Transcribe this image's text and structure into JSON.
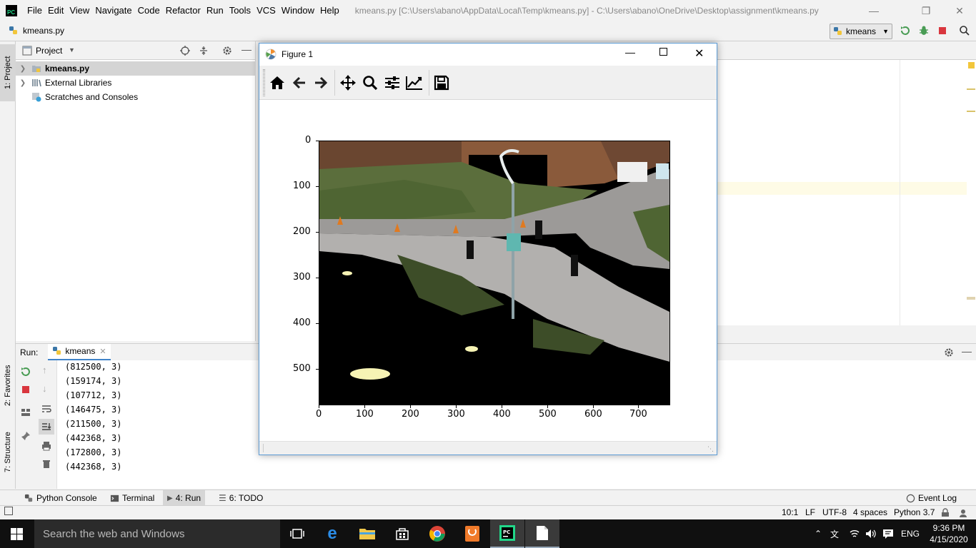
{
  "app": {
    "logo_text": "PC",
    "menu": [
      "File",
      "Edit",
      "View",
      "Navigate",
      "Code",
      "Refactor",
      "Run",
      "Tools",
      "VCS",
      "Window",
      "Help"
    ],
    "window_title": "kmeans.py [C:\\Users\\abano\\AppData\\Local\\Temp\\kmeans.py] - C:\\Users\\abano\\OneDrive\\Desktop\\assignment\\kmeans.py"
  },
  "navbar": {
    "file": "kmeans.py",
    "run_config": "kmeans"
  },
  "left_strip": {
    "project_tab": "1: Project",
    "favorites_tab": "2: Favorites",
    "structure_tab": "7: Structure"
  },
  "project": {
    "title": "Project",
    "items": [
      {
        "label": "kmeans.py"
      },
      {
        "label": "External Libraries"
      },
      {
        "label": "Scratches and Consoles"
      }
    ]
  },
  "figure": {
    "title": "Figure 1",
    "x_ticks": [
      "0",
      "100",
      "200",
      "300",
      "400",
      "500",
      "600",
      "700"
    ],
    "y_ticks": [
      "0",
      "100",
      "200",
      "300",
      "400",
      "500"
    ]
  },
  "run": {
    "label": "Run:",
    "tab": "kmeans",
    "output": [
      "(812500, 3)",
      "(159174, 3)",
      "(107712, 3)",
      "(146475, 3)",
      "(211500, 3)",
      "(442368, 3)",
      "(172800, 3)",
      "(442368, 3)"
    ]
  },
  "bottom_tools": {
    "python_console": "Python Console",
    "terminal": "Terminal",
    "run": "4: Run",
    "todo": "6: TODO",
    "event_log": "Event Log"
  },
  "status": {
    "position": "10:1",
    "line_sep": "LF",
    "encoding": "UTF-8",
    "indent": "4 spaces",
    "interpreter": "Python 3.7"
  },
  "taskbar": {
    "search_placeholder": "Search the web and Windows",
    "language": "ENG",
    "time": "9:36 PM",
    "date": "4/15/2020"
  },
  "colors": {
    "accent_green": "#21d789",
    "stop_red": "#d9363e",
    "figure_border": "#5b9bd5"
  }
}
